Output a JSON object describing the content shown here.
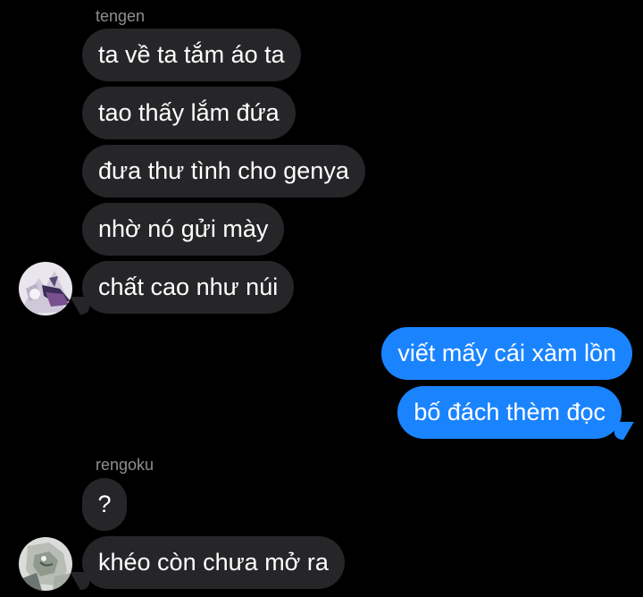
{
  "conversation": {
    "sender_1": "tengen",
    "sender_2": "rengoku",
    "messages_1": [
      "ta về ta tắm áo ta",
      "tao thấy lắm đứa",
      "đưa thư tình cho genya",
      "nhờ nó gửi mày",
      "chất cao như núi"
    ],
    "outgoing": [
      "viết mấy cái xàm lồn",
      "bố đách thèm đọc"
    ],
    "messages_2": [
      "?",
      "khéo còn chưa mở ra"
    ]
  },
  "colors": {
    "background": "#000000",
    "incoming_bubble": "#262629",
    "outgoing_bubble": "#1a84ff",
    "sender_name": "#8e8e93",
    "text": "#ffffff"
  }
}
